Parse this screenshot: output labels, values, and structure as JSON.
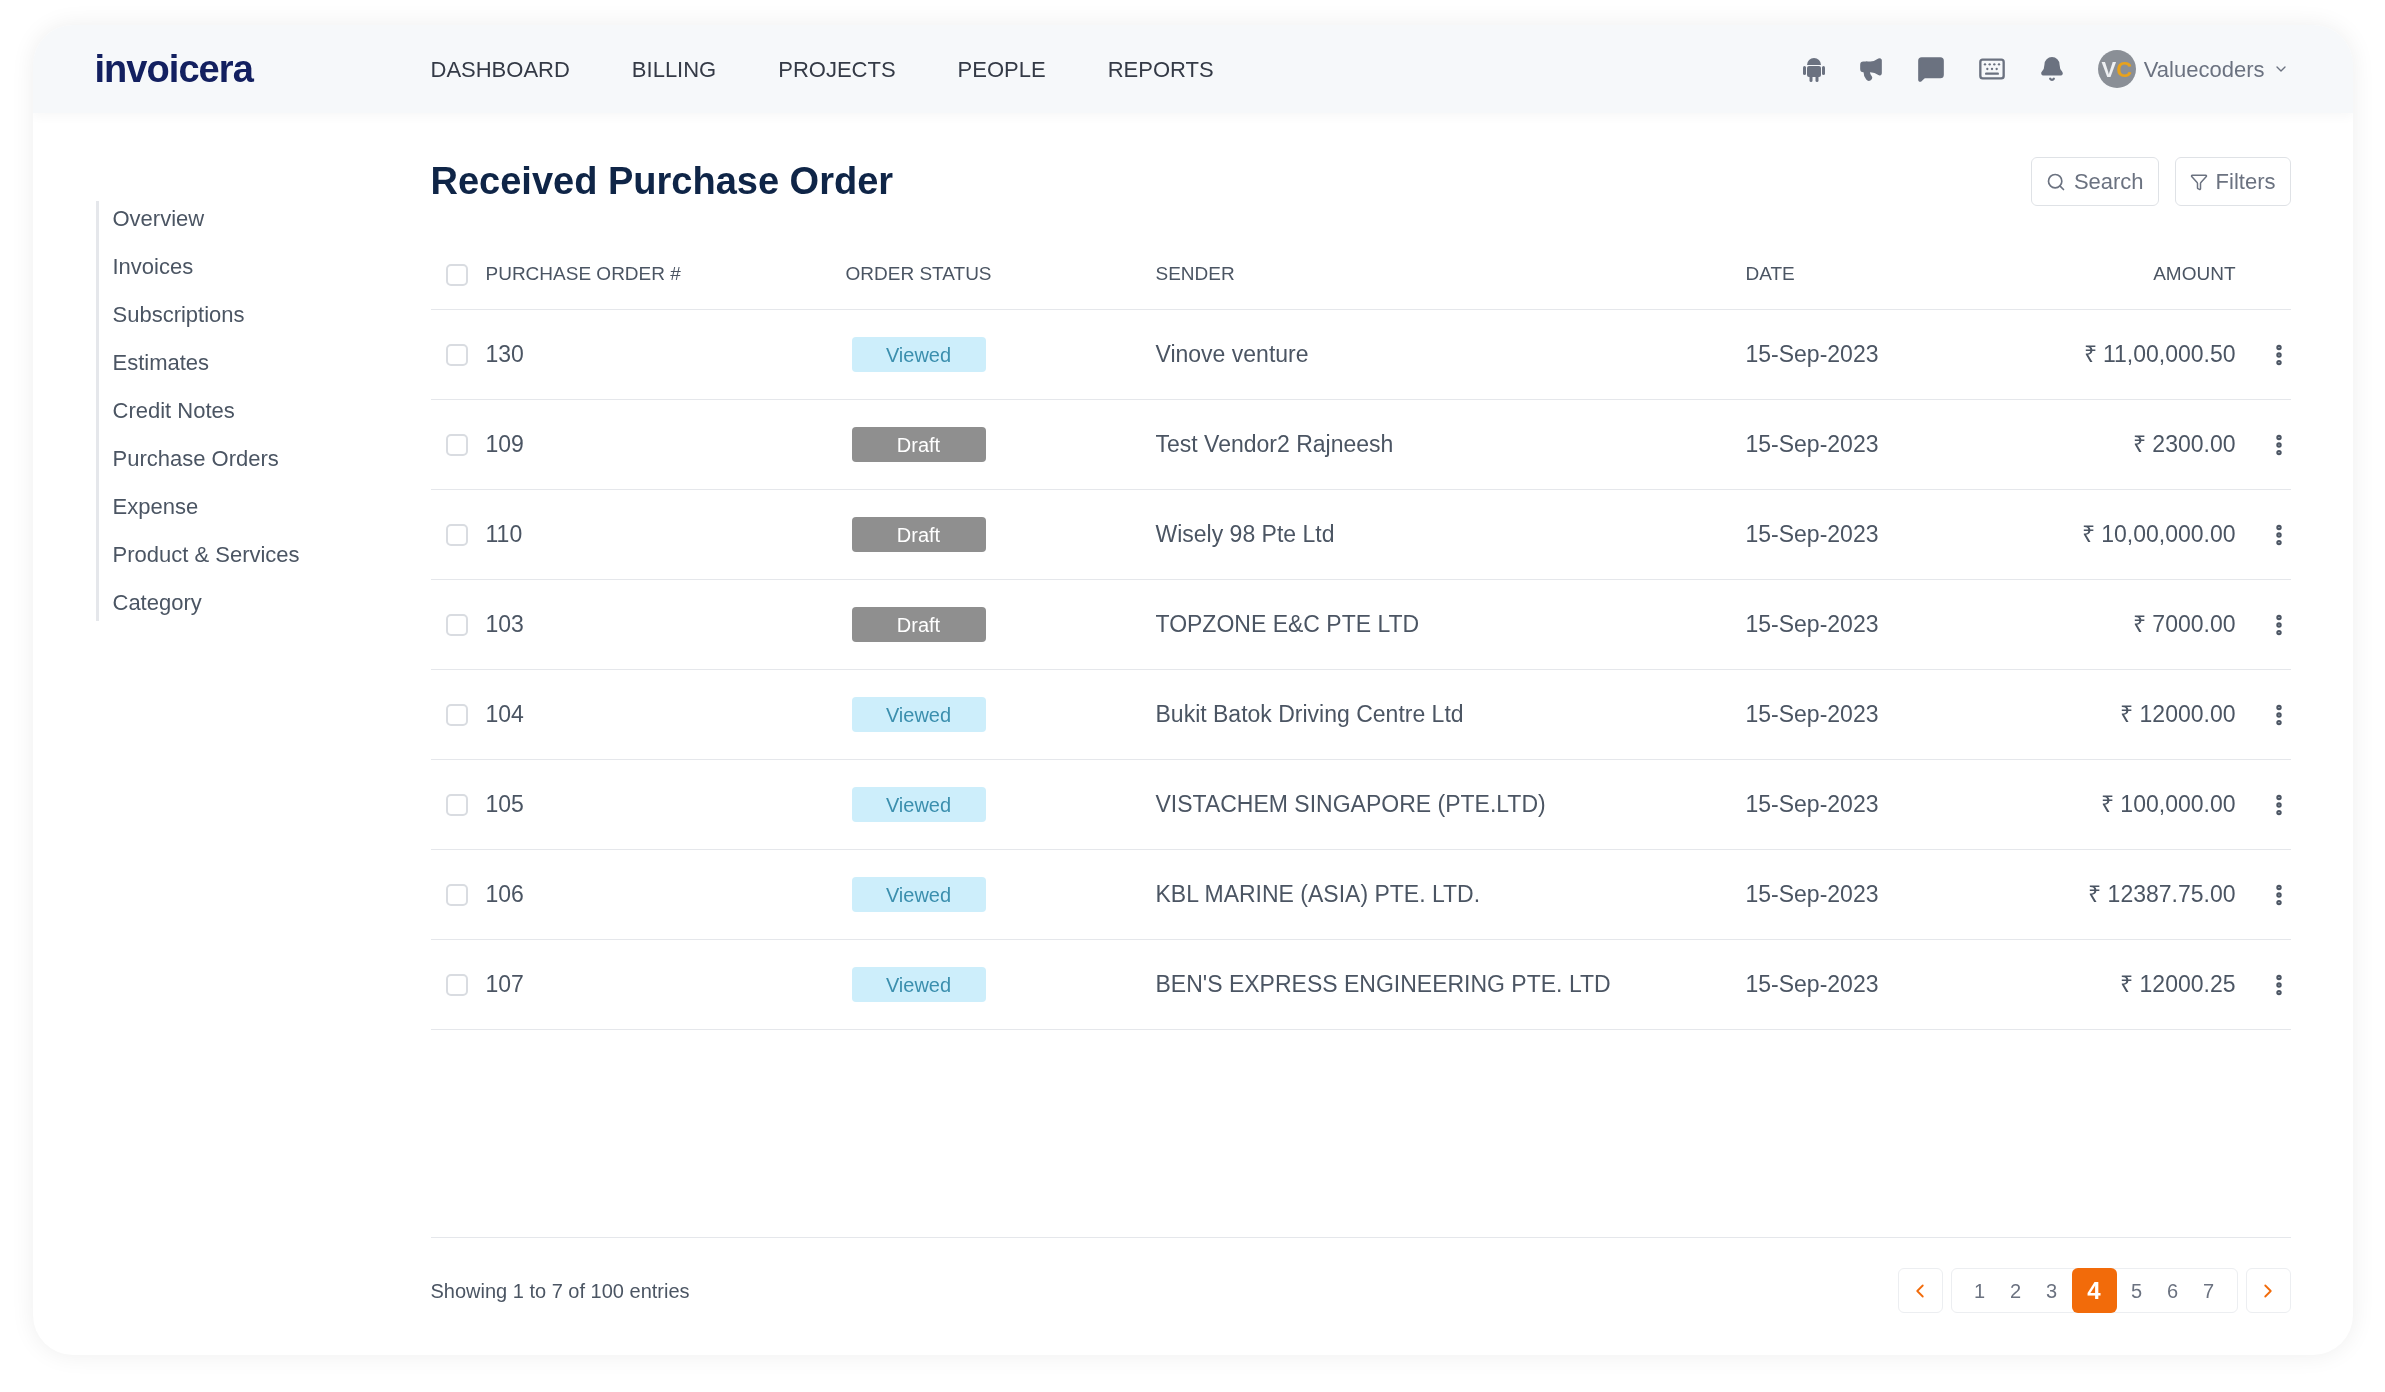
{
  "header": {
    "logo": "invoicera",
    "nav": [
      {
        "label": "DASHBOARD"
      },
      {
        "label": "BILLING"
      },
      {
        "label": "PROJECTS"
      },
      {
        "label": "PEOPLE"
      },
      {
        "label": "REPORTS"
      }
    ],
    "avatar_initials": "VC",
    "user": "Valuecoders"
  },
  "sidebar": {
    "items": [
      {
        "label": "Overview"
      },
      {
        "label": "Invoices"
      },
      {
        "label": "Subscriptions"
      },
      {
        "label": "Estimates"
      },
      {
        "label": "Credit Notes"
      },
      {
        "label": "Purchase Orders"
      },
      {
        "label": "Expense"
      },
      {
        "label": "Product & Services"
      },
      {
        "label": "Category"
      }
    ]
  },
  "page": {
    "title": "Received Purchase Order",
    "search": "Search",
    "filters": "Filters"
  },
  "table": {
    "select_all_checked": false,
    "columns": [
      "PURCHASE ORDER #",
      "ORDER STATUS",
      "SENDER",
      "DATE",
      "AMOUNT"
    ],
    "rows": [
      {
        "checked": false,
        "number": "130",
        "status": {
          "kind": "viewed",
          "label": "Viewed"
        },
        "sender": "Vinove venture",
        "date": "15-Sep-2023",
        "amount": "₹ 11,00,000.50"
      },
      {
        "checked": false,
        "number": "109",
        "status": {
          "kind": "draft",
          "label": "Draft"
        },
        "sender": "Test Vendor2 Rajneesh",
        "date": "15-Sep-2023",
        "amount": "₹ 2300.00"
      },
      {
        "checked": false,
        "number": "110",
        "status": {
          "kind": "draft",
          "label": "Draft"
        },
        "sender": "Wisely 98 Pte Ltd",
        "date": "15-Sep-2023",
        "amount": "₹ 10,00,000.00"
      },
      {
        "checked": false,
        "number": "103",
        "status": {
          "kind": "draft",
          "label": "Draft"
        },
        "sender": "TOPZONE E&C PTE LTD",
        "date": "15-Sep-2023",
        "amount": "₹ 7000.00"
      },
      {
        "checked": false,
        "number": "104",
        "status": {
          "kind": "viewed",
          "label": "Viewed"
        },
        "sender": "Bukit Batok Driving Centre Ltd",
        "date": "15-Sep-2023",
        "amount": "₹ 12000.00"
      },
      {
        "checked": false,
        "number": "105",
        "status": {
          "kind": "viewed",
          "label": "Viewed"
        },
        "sender": "VISTACHEM SINGAPORE (PTE.LTD)",
        "date": "15-Sep-2023",
        "amount": "₹ 100,000.00"
      },
      {
        "checked": false,
        "number": "106",
        "status": {
          "kind": "viewed",
          "label": "Viewed"
        },
        "sender": "KBL MARINE (ASIA) PTE. LTD.",
        "date": "15-Sep-2023",
        "amount": "₹ 12387.75.00"
      },
      {
        "checked": false,
        "number": "107",
        "status": {
          "kind": "viewed",
          "label": "Viewed"
        },
        "sender": "BEN'S EXPRESS ENGINEERING PTE. LTD",
        "date": "15-Sep-2023",
        "amount": "₹ 12000.25"
      }
    ]
  },
  "footer": {
    "summary": "Showing 1 to 7 of 100 entries",
    "pages": [
      {
        "label": "1",
        "selected": false
      },
      {
        "label": "2",
        "selected": false
      },
      {
        "label": "3",
        "selected": false
      },
      {
        "label": "4",
        "selected": true
      },
      {
        "label": "5",
        "selected": false
      },
      {
        "label": "6",
        "selected": false
      },
      {
        "label": "7",
        "selected": false
      }
    ]
  }
}
